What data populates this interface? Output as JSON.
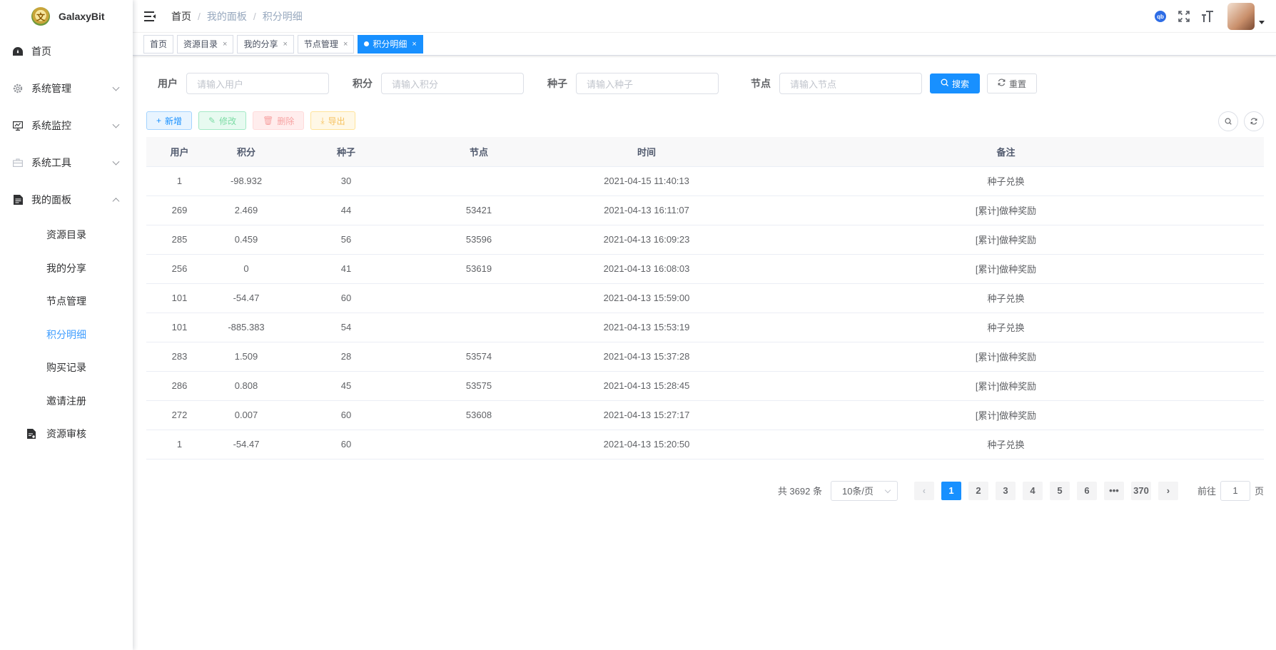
{
  "app": {
    "name": "GalaxyBit"
  },
  "sidebar": {
    "items": [
      {
        "label": "首页",
        "icon": "dashboard-icon"
      },
      {
        "label": "系统管理",
        "icon": "gear-icon"
      },
      {
        "label": "系统监控",
        "icon": "monitor-icon"
      },
      {
        "label": "系统工具",
        "icon": "toolbox-icon"
      },
      {
        "label": "我的面板",
        "icon": "document-icon"
      }
    ],
    "sub_items": [
      {
        "label": "资源目录"
      },
      {
        "label": "我的分享"
      },
      {
        "label": "节点管理"
      },
      {
        "label": "积分明细"
      },
      {
        "label": "购买记录"
      },
      {
        "label": "邀请注册"
      }
    ],
    "extra": {
      "label": "资源审核",
      "icon": "audit-icon"
    }
  },
  "navbar": {
    "breadcrumb": [
      "首页",
      "我的面板",
      "积分明细"
    ],
    "qb_label": "qb"
  },
  "tabs": [
    {
      "label": "首页"
    },
    {
      "label": "资源目录"
    },
    {
      "label": "我的分享"
    },
    {
      "label": "节点管理"
    },
    {
      "label": "积分明细"
    }
  ],
  "filter": {
    "user": {
      "label": "用户",
      "placeholder": "请输入用户"
    },
    "points": {
      "label": "积分",
      "placeholder": "请输入积分"
    },
    "seed": {
      "label": "种子",
      "placeholder": "请输入种子"
    },
    "node": {
      "label": "节点",
      "placeholder": "请输入节点"
    },
    "search": "搜索",
    "reset": "重置"
  },
  "toolbar": {
    "add": "新增",
    "edit": "修改",
    "delete": "删除",
    "export": "导出"
  },
  "table": {
    "headers": [
      "用户",
      "积分",
      "种子",
      "节点",
      "时间",
      "备注"
    ],
    "rows": [
      [
        "1",
        "-98.932",
        "30",
        "",
        "2021-04-15 11:40:13",
        "种子兑换"
      ],
      [
        "269",
        "2.469",
        "44",
        "53421",
        "2021-04-13 16:11:07",
        "[累计]做种奖励"
      ],
      [
        "285",
        "0.459",
        "56",
        "53596",
        "2021-04-13 16:09:23",
        "[累计]做种奖励"
      ],
      [
        "256",
        "0",
        "41",
        "53619",
        "2021-04-13 16:08:03",
        "[累计]做种奖励"
      ],
      [
        "101",
        "-54.47",
        "60",
        "",
        "2021-04-13 15:59:00",
        "种子兑换"
      ],
      [
        "101",
        "-885.383",
        "54",
        "",
        "2021-04-13 15:53:19",
        "种子兑换"
      ],
      [
        "283",
        "1.509",
        "28",
        "53574",
        "2021-04-13 15:37:28",
        "[累计]做种奖励"
      ],
      [
        "286",
        "0.808",
        "45",
        "53575",
        "2021-04-13 15:28:45",
        "[累计]做种奖励"
      ],
      [
        "272",
        "0.007",
        "60",
        "53608",
        "2021-04-13 15:27:17",
        "[累计]做种奖励"
      ],
      [
        "1",
        "-54.47",
        "60",
        "",
        "2021-04-13 15:20:50",
        "种子兑换"
      ]
    ]
  },
  "pagination": {
    "total_text": "共 3692 条",
    "page_size": "10条/页",
    "pages": [
      "1",
      "2",
      "3",
      "4",
      "5",
      "6",
      "•••",
      "370"
    ],
    "current": "1",
    "goto_prefix": "前往",
    "goto_value": "1",
    "goto_suffix": "页"
  },
  "colors": {
    "primary": "#1890ff",
    "active_menu": "#409eff"
  }
}
